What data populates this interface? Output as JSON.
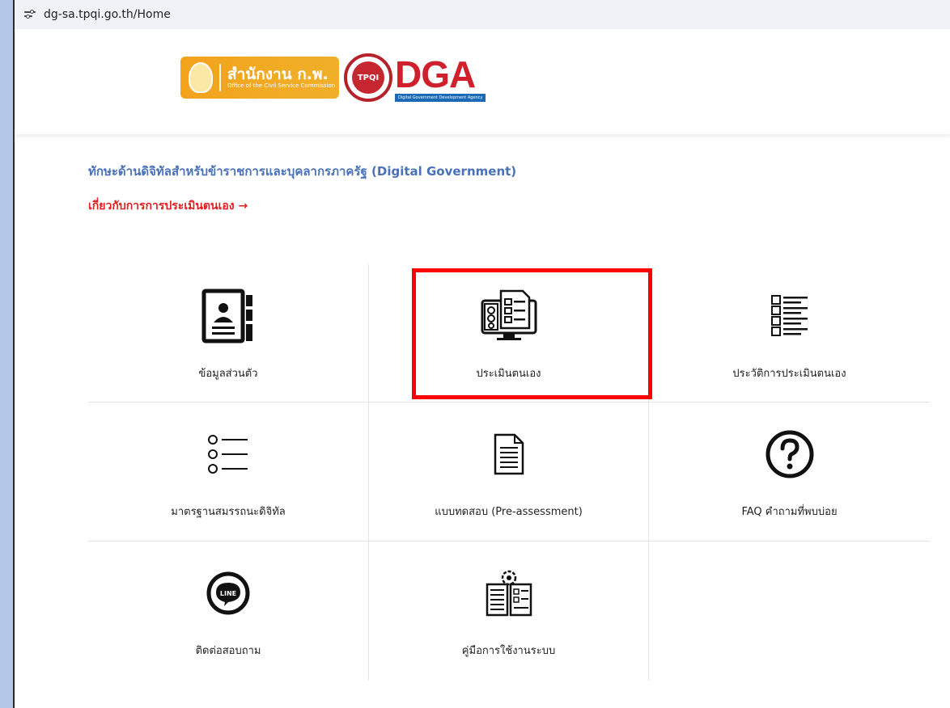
{
  "browser": {
    "url": "dg-sa.tpqi.go.th/Home"
  },
  "header": {
    "ocsc_logo_text": "สำนักงาน ก.พ.",
    "ocsc_logo_subtext": "Office of the Civil Service Commission",
    "tpqi_logo_text": "TPQI",
    "dga_logo_text": "DGA",
    "dga_logo_tagline": "Digital Government Development Agency"
  },
  "main": {
    "title": "ทักษะด้านดิจิทัลสำหรับข้าราชการและบุคลากรภาครัฐ (Digital Government)",
    "about_link": "เกี่ยวกับการการประเมินตนเอง →"
  },
  "menu": {
    "tiles": [
      {
        "label": "ข้อมูลส่วนตัว",
        "icon": "profile-card-icon"
      },
      {
        "label": "ประเมินตนเอง",
        "icon": "assessment-checklist-icon",
        "highlighted": true
      },
      {
        "label": "ประวัติการประเมินตนเอง",
        "icon": "history-list-icon"
      },
      {
        "label": "มาตรฐานสมรรถนะดิจิทัล",
        "icon": "bullet-list-icon"
      },
      {
        "label": "แบบทดสอบ (Pre-assessment)",
        "icon": "document-icon"
      },
      {
        "label": "FAQ คำถามที่พบบ่อย",
        "icon": "question-circle-icon"
      },
      {
        "label": "ติดต่อสอบถาม",
        "icon": "line-icon"
      },
      {
        "label": "คู่มือการใช้งานระบบ",
        "icon": "manual-book-icon"
      }
    ]
  },
  "colors": {
    "title": "#4a72b8",
    "link": "#e02020",
    "highlight_border": "#ff0000",
    "page_background": "#b4c7e7"
  }
}
